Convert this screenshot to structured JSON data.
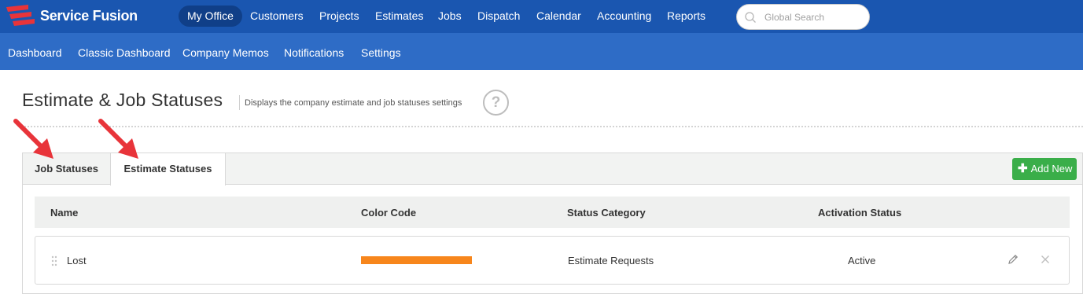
{
  "app": {
    "brand": "Service Fusion"
  },
  "topnav": {
    "items": [
      "My Office",
      "Customers",
      "Projects",
      "Estimates",
      "Jobs",
      "Dispatch",
      "Calendar",
      "Accounting",
      "Reports"
    ],
    "active": "My Office",
    "search_placeholder": "Global Search"
  },
  "subnav": {
    "items": [
      "Dashboard",
      "Classic Dashboard",
      "Company Memos",
      "Notifications",
      "Settings"
    ]
  },
  "page": {
    "title": "Estimate & Job Statuses",
    "subtitle": "Displays the company estimate and job statuses settings",
    "help": "?"
  },
  "tabs": [
    {
      "label": "Job Statuses",
      "active": false
    },
    {
      "label": "Estimate Statuses",
      "active": true
    }
  ],
  "toolbar": {
    "add_new": "Add New"
  },
  "table": {
    "columns": [
      "Name",
      "Color Code",
      "Status Category",
      "Activation Status"
    ],
    "rows": [
      {
        "name": "Lost",
        "color": "#f7861c",
        "category": "Estimate Requests",
        "activation": "Active"
      }
    ]
  },
  "colors": {
    "topbar": "#1a56b0",
    "subbar": "#2e6cc6",
    "add_button": "#3aae49",
    "arrow": "#e8343a"
  },
  "icons": [
    "logo-icon",
    "search-icon",
    "help-icon",
    "drag-handle-icon",
    "edit-icon",
    "delete-icon",
    "plus-icon",
    "arrow-annotation"
  ]
}
